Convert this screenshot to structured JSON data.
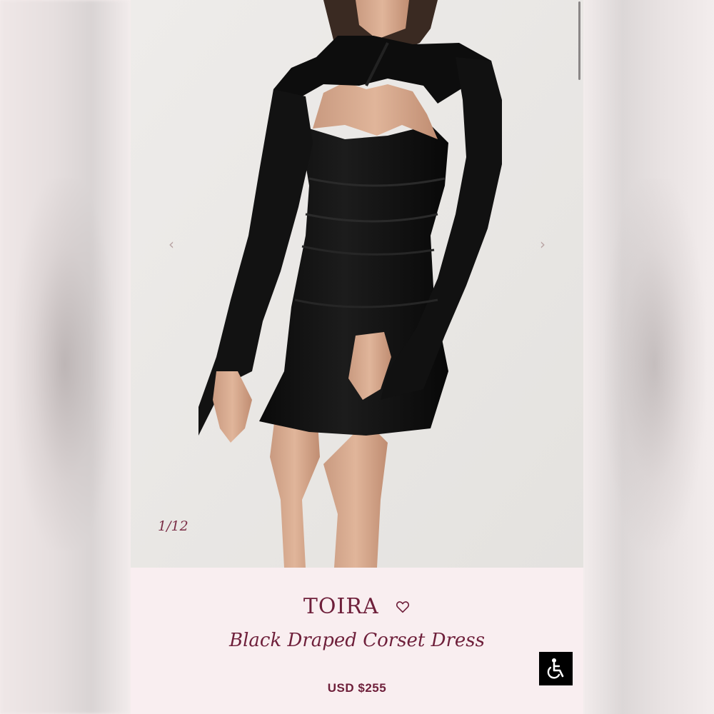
{
  "gallery": {
    "counter": "1/12",
    "prev_icon": "chevron-left-icon",
    "next_icon": "chevron-right-icon",
    "prev_glyph": "‹",
    "next_glyph": "›",
    "image_alt": "model wearing black long-sleeve cutout mini dress"
  },
  "product": {
    "brand": "TOIRA",
    "name": "Black Draped Corset Dress",
    "price": "USD $255",
    "wishlist_icon": "heart-outline-icon"
  },
  "accessibility": {
    "icon": "wheelchair-icon"
  },
  "colors": {
    "accent": "#6e1f3a",
    "info_background": "#f9eef0",
    "gallery_background": "#eceae8"
  }
}
